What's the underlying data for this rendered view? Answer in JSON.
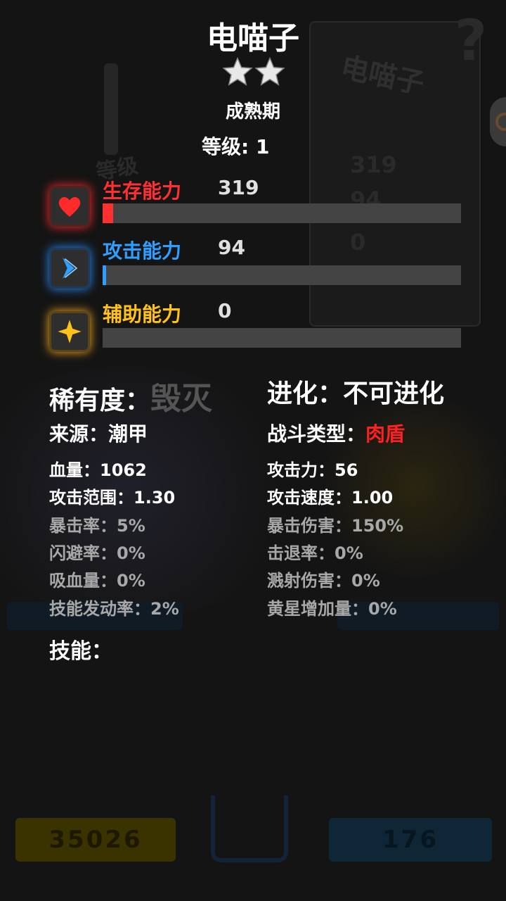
{
  "title": "电喵子",
  "stars": 2,
  "stage": "成熟期",
  "level": "等级: 1",
  "stats": [
    {
      "label": "生存能力",
      "value": "319",
      "fill": 0.03,
      "color": "#ff3030",
      "icon": "heart-icon"
    },
    {
      "label": "攻击能力",
      "value": "94",
      "fill": 0.01,
      "color": "#2f9fff",
      "icon": "chevron-right-icon"
    },
    {
      "label": "辅助能力",
      "value": "0",
      "fill": 0.0,
      "color": "#ffc21a",
      "icon": "sparkle-star-icon"
    }
  ],
  "rarity": {
    "label": "稀有度：",
    "value": "毁灭"
  },
  "evolution": "进化：不可进化",
  "source": "来源：潮甲",
  "battle_type": {
    "label": "战斗类型：",
    "value": "肉盾"
  },
  "attributes_left": [
    "血量：1062",
    "攻击范围：1.30",
    "暴击率：5%",
    "闪避率：0%",
    "吸血量：0%",
    "技能发动率：2%"
  ],
  "attributes_right": [
    "攻击力：56",
    "攻击速度：1.00",
    "暴击伤害：150%",
    "击退率：0%",
    "溅射伤害：0%",
    "黄星增加量：0%"
  ],
  "skills_label": "技能：",
  "background": {
    "card_name": "电喵子",
    "card_values": [
      "319",
      "94",
      "0"
    ],
    "card_level_label": "等级",
    "gold": "35026",
    "gems": "176"
  }
}
